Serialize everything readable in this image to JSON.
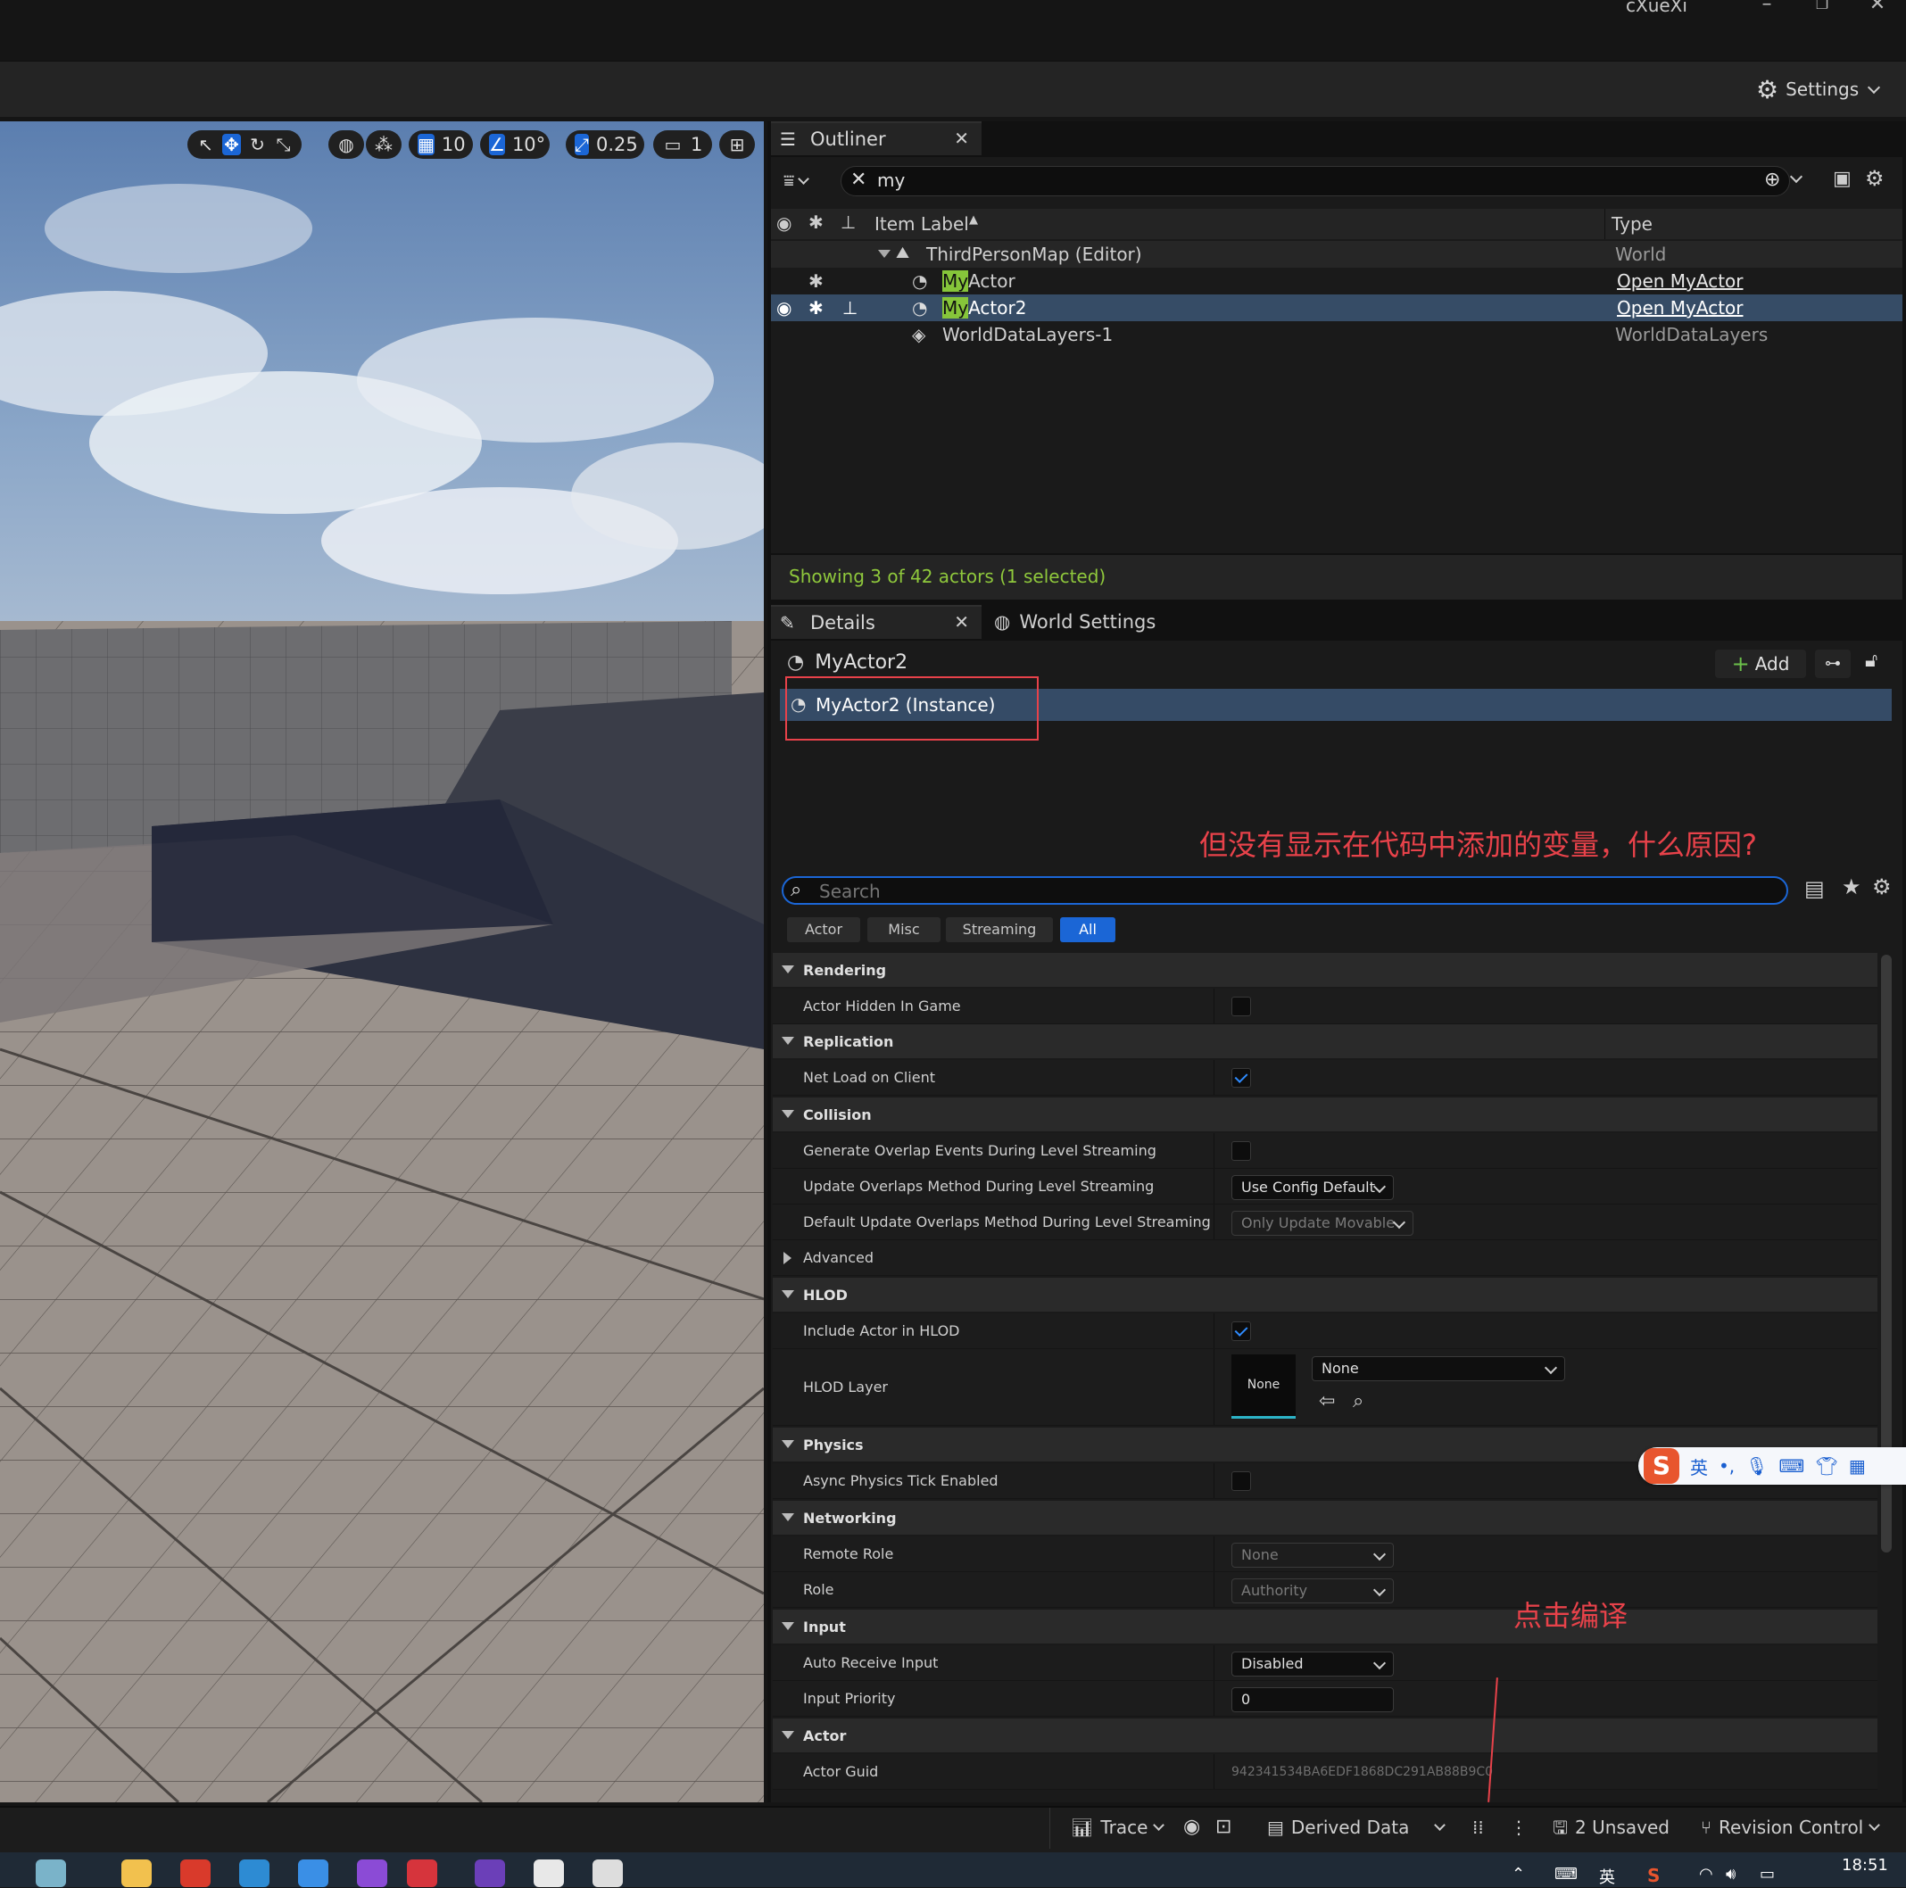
{
  "window": {
    "user": "cXueXi"
  },
  "toolbar": {
    "settings_label": "Settings"
  },
  "viewport_toolbar": {
    "grid_snap": "10",
    "angle_snap": "10°",
    "scale_snap": "0.25",
    "camera_speed": "1"
  },
  "outliner": {
    "tab_label": "Outliner",
    "search_value": "my",
    "col_label": "Item Label",
    "col_type": "Type",
    "rows": [
      {
        "label": "ThirdPersonMap (Editor)",
        "type": "World"
      },
      {
        "label_hl": "My",
        "label_rest": "Actor",
        "type": "Open MyActor"
      },
      {
        "label_hl": "My",
        "label_rest": "Actor2",
        "type": "Open MyActor"
      },
      {
        "label": "WorldDataLayers-1",
        "type": "WorldDataLayers"
      }
    ],
    "status": "Showing 3 of 42 actors (1 selected)"
  },
  "details": {
    "tab_label": "Details",
    "world_settings_tab": "World Settings",
    "actor_name": "MyActor2",
    "add_label": "Add",
    "instance_label": "MyActor2 (Instance)",
    "annotation_question": "但没有显示在代码中添加的变量，什么原因?",
    "annotation_compile": "点击编译",
    "search_placeholder": "Search",
    "filters": [
      "Actor",
      "Misc",
      "Streaming",
      "All"
    ],
    "categories": {
      "rendering": "Rendering",
      "replication": "Replication",
      "collision": "Collision",
      "advanced": "Advanced",
      "hlod": "HLOD",
      "physics": "Physics",
      "networking": "Networking",
      "input": "Input",
      "actor": "Actor"
    },
    "props": {
      "actor_hidden": "Actor Hidden In Game",
      "net_load": "Net Load on Client",
      "gen_overlap": "Generate Overlap Events During Level Streaming",
      "update_overlap": "Update Overlaps Method During Level Streaming",
      "update_overlap_val": "Use Config Default",
      "default_update_overlap": "Default Update Overlaps Method During Level Streaming",
      "default_update_overlap_val": "Only Update Movable",
      "include_hlod": "Include Actor in HLOD",
      "hlod_layer": "HLOD Layer",
      "hlod_thumb": "None",
      "hlod_layer_val": "None",
      "async_physics": "Async Physics Tick Enabled",
      "remote_role": "Remote Role",
      "remote_role_val": "None",
      "role": "Role",
      "role_val": "Authority",
      "auto_receive": "Auto Receive Input",
      "auto_receive_val": "Disabled",
      "input_priority": "Input Priority",
      "input_priority_val": "0",
      "actor_guid": "Actor Guid",
      "actor_guid_val": "942341534BA6EDF1868DC291AB88B9C0"
    }
  },
  "ime": {
    "lang": "英"
  },
  "statusbar": {
    "trace": "Trace",
    "derived_data": "Derived Data",
    "unsaved": "2 Unsaved",
    "revision_control": "Revision Control"
  },
  "taskbar": {
    "time": "18:51",
    "ime_lang": "英"
  },
  "colors": {
    "accent": "#1b66d6",
    "selection": "#364c66",
    "highlight": "#86c53a",
    "annotation": "#e8424a",
    "status_green": "#8fc83c"
  }
}
